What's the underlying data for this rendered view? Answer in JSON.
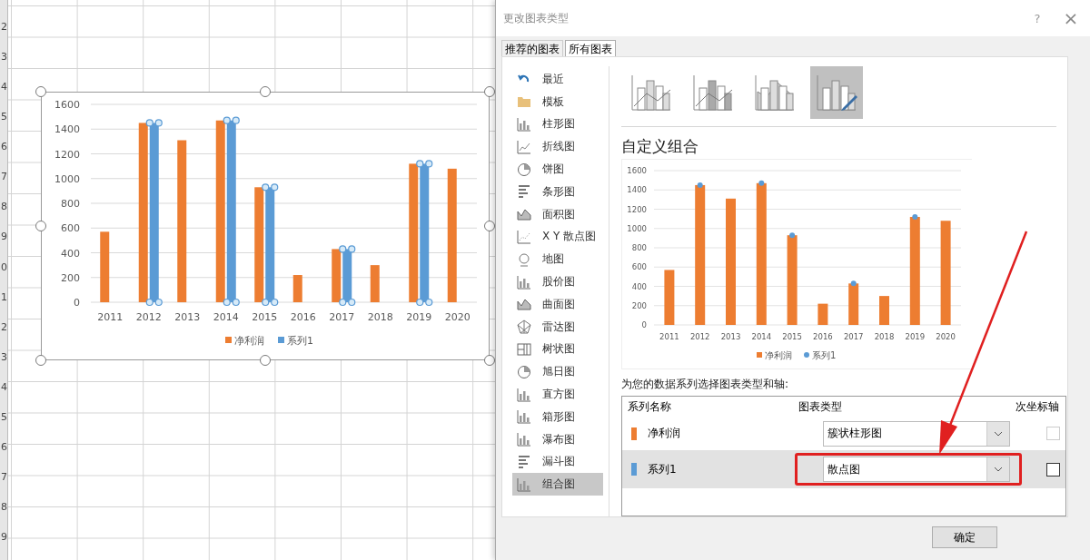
{
  "sheet": {
    "row_numbers": [
      "2",
      "3",
      "4",
      "5",
      "6",
      "7",
      "8",
      "9",
      "0",
      "1",
      "2",
      "3",
      "4",
      "5",
      "6",
      "7",
      "8",
      "9"
    ],
    "chart": {
      "chart_data": {
        "type": "bar",
        "grid": true,
        "legend": "bottom",
        "categories": [
          "2011",
          "2012",
          "2013",
          "2014",
          "2015",
          "2016",
          "2017",
          "2018",
          "2019",
          "2020"
        ],
        "ylim": [
          0,
          1600
        ],
        "yticks": [
          0,
          200,
          400,
          600,
          800,
          1000,
          1200,
          1400,
          1600
        ],
        "series": [
          {
            "name": "净利润",
            "color": "#ed7d31",
            "values": [
              570,
              1450,
              1310,
              1470,
              930,
              220,
              430,
              300,
              1120,
              1080
            ]
          },
          {
            "name": "系列1",
            "color": "#5b9bd5",
            "values": [
              null,
              1450,
              null,
              1470,
              930,
              null,
              430,
              null,
              1120,
              null
            ]
          }
        ]
      }
    }
  },
  "dialog": {
    "title": "更改图表类型",
    "help": "?",
    "close": "×",
    "tabs": [
      {
        "label": "推荐的图表",
        "selected": false
      },
      {
        "label": "所有图表",
        "selected": true
      }
    ],
    "chart_types": [
      {
        "label": "最近",
        "selected": false
      },
      {
        "label": "模板",
        "selected": false
      },
      {
        "label": "柱形图",
        "selected": false
      },
      {
        "label": "折线图",
        "selected": false
      },
      {
        "label": "饼图",
        "selected": false
      },
      {
        "label": "条形图",
        "selected": false
      },
      {
        "label": "面积图",
        "selected": false
      },
      {
        "label": "X Y 散点图",
        "selected": false
      },
      {
        "label": "地图",
        "selected": false
      },
      {
        "label": "股价图",
        "selected": false
      },
      {
        "label": "曲面图",
        "selected": false
      },
      {
        "label": "雷达图",
        "selected": false
      },
      {
        "label": "树状图",
        "selected": false
      },
      {
        "label": "旭日图",
        "selected": false
      },
      {
        "label": "直方图",
        "selected": false
      },
      {
        "label": "箱形图",
        "selected": false
      },
      {
        "label": "瀑布图",
        "selected": false
      },
      {
        "label": "漏斗图",
        "selected": false
      },
      {
        "label": "组合图",
        "selected": true
      }
    ],
    "subtypes": [
      {
        "selected": false
      },
      {
        "selected": false
      },
      {
        "selected": false
      },
      {
        "selected": true
      }
    ],
    "heading": "自定义组合",
    "preview": {
      "chart_data": {
        "type": "bar",
        "grid": true,
        "legend": "bottom",
        "categories": [
          "2011",
          "2012",
          "2013",
          "2014",
          "2015",
          "2016",
          "2017",
          "2018",
          "2019",
          "2020"
        ],
        "ylim": [
          0,
          1600
        ],
        "yticks": [
          0,
          200,
          400,
          600,
          800,
          1000,
          1200,
          1400,
          1600
        ],
        "series": [
          {
            "name": "净利润",
            "type": "bar",
            "color": "#ed7d31",
            "values": [
              570,
              1450,
              1310,
              1470,
              930,
              220,
              430,
              300,
              1120,
              1080
            ]
          },
          {
            "name": "系列1",
            "type": "scatter",
            "color": "#5b9bd5",
            "values": [
              null,
              1450,
              null,
              1470,
              930,
              null,
              430,
              null,
              1120,
              null
            ]
          }
        ]
      }
    },
    "series_prompt": "为您的数据系列选择图表类型和轴:",
    "columns": [
      "系列名称",
      "图表类型",
      "次坐标轴"
    ],
    "series": [
      {
        "name": "净利润",
        "color": "#ed7d31",
        "chart_type": "簇状柱形图",
        "secondary_axis": false,
        "disabled": true,
        "selected": false
      },
      {
        "name": "系列1",
        "color": "#5b9bd5",
        "chart_type": "散点图",
        "secondary_axis": false,
        "disabled": false,
        "selected": true
      }
    ],
    "ok": "确定"
  }
}
